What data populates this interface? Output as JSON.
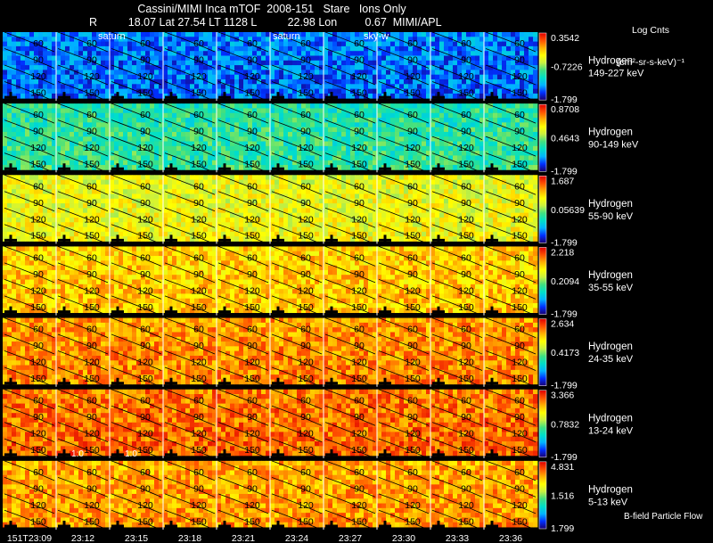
{
  "header": {
    "title": "Cassini/MIMI Inca mTOF  2008-151   Stare   Ions Only",
    "info": "R          18.07 Lat 27.54 LT 1128 L          22.98 Lon         0.67  MIMI/APL",
    "colorbar_label_line1": "Log Cnts",
    "colorbar_label_line2": "(cm²-sr-s-keV)⁻¹"
  },
  "overlay_labels": {
    "top_strip": [
      "saturn",
      "saturn",
      "sky-w"
    ],
    "bottom_strip": [
      "1:0",
      "1:0"
    ],
    "footer_legend": "B-field Particle Flow"
  },
  "colors": {
    "background": "#000000",
    "text": "#ffffff",
    "colormap": [
      "#1a0070",
      "#0030ff",
      "#00b4ff",
      "#00e0c8",
      "#40e080",
      "#c8f040",
      "#ffff00",
      "#ffb000",
      "#ff5000",
      "#e00000"
    ]
  },
  "chart_data": {
    "type": "heatmap",
    "time_labels": [
      "151T23:09",
      "23:12",
      "23:15",
      "23:18",
      "23:21",
      "23:24",
      "23:27",
      "23:30",
      "23:33",
      "23:36"
    ],
    "pitch_angle_contours": [
      "60",
      "90",
      "120",
      "150"
    ],
    "rows": [
      {
        "species": "Hydrogen",
        "energy": "149-227 keV",
        "cmax": "0.3542",
        "cmid": "-0.7226",
        "cmin": "-1.799",
        "level": 0.18
      },
      {
        "species": "Hydrogen",
        "energy": "90-149 keV",
        "cmax": "0.8708",
        "cmid": "0.4643",
        "cmin": "-1.799",
        "level": 0.38
      },
      {
        "species": "Hydrogen",
        "energy": "55-90 keV",
        "cmax": "1.687",
        "cmid": "0.05639",
        "cmin": "-1.799",
        "level": 0.62
      },
      {
        "species": "Hydrogen",
        "energy": "35-55 keV",
        "cmax": "2.218",
        "cmid": "0.2094",
        "cmin": "-1.799",
        "level": 0.72
      },
      {
        "species": "Hydrogen",
        "energy": "24-35 keV",
        "cmax": "2.634",
        "cmid": "0.4173",
        "cmin": "-1.799",
        "level": 0.8
      },
      {
        "species": "Hydrogen",
        "energy": "13-24 keV",
        "cmax": "3.366",
        "cmid": "0.7832",
        "cmin": "-1.799",
        "level": 0.84
      },
      {
        "species": "Hydrogen",
        "energy": "5-13 keV",
        "cmax": "4.831",
        "cmid": "1.516",
        "cmin": "1.799",
        "level": 0.78
      }
    ]
  }
}
